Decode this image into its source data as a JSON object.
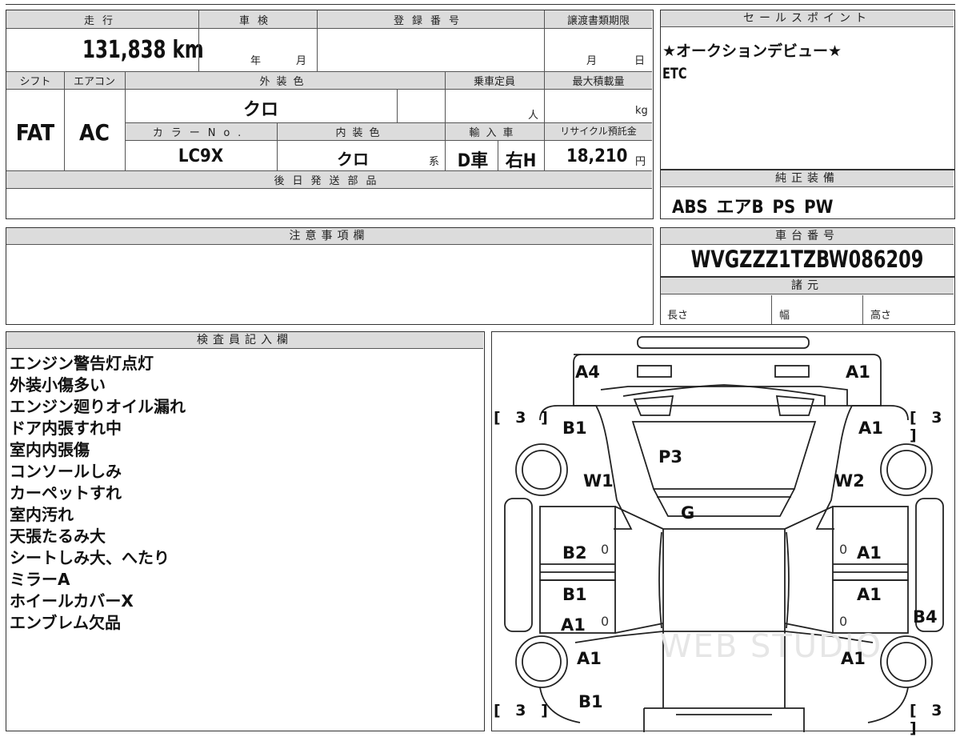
{
  "summary": {
    "headers": {
      "mileage": "走行",
      "inspection": "車検",
      "registration": "登録番号",
      "transfer_deadline": "譲渡書類期限",
      "shift": "シフト",
      "aircon": "エアコン",
      "exterior_color": "外装色",
      "capacity": "乗車定員",
      "max_load": "最大積載量",
      "color_no": "カラーNo.",
      "interior_color": "内装色",
      "import": "輸入車",
      "recycle_fee": "リサイクル預託金",
      "later_parts": "後日発送部品"
    },
    "mileage": "131,838 km",
    "inspection_year_unit": "年",
    "inspection_month_unit": "月",
    "deadline_month_unit": "月",
    "deadline_day_unit": "日",
    "shift": "FAT",
    "aircon": "AC",
    "exterior_color": "クロ",
    "capacity_unit": "人",
    "load_unit": "kg",
    "color_no": "LC9X",
    "interior_color": "クロ",
    "interior_suffix": "系",
    "import_type": "D車",
    "steering": "右H",
    "recycle_fee": "18,210",
    "recycle_unit": "円"
  },
  "sales_point": {
    "header": "セールスポイント",
    "line1": "★オークションデビュー★",
    "line2": "ETC"
  },
  "equipment": {
    "header": "純正装備",
    "items": "ABS エアB PS PW"
  },
  "notes": {
    "header": "注意事項欄"
  },
  "chassis": {
    "header": "車台番号",
    "number": "WVGZZZ1TZBW086209"
  },
  "specs": {
    "header": "諸元",
    "length": "長さ",
    "width": "幅",
    "height": "高さ"
  },
  "inspector": {
    "header": "検査員記入欄",
    "items": [
      "エンジン警告灯点灯",
      "外装小傷多い",
      "エンジン廻りオイル漏れ",
      "ドア内張すれ中",
      "室内内張傷",
      "コンソールしみ",
      "カーペットすれ",
      "室内汚れ",
      "天張たるみ大",
      "シートしみ大、へたり",
      "ミラーA",
      "ホイールカバーX",
      "エンブレム欠品"
    ]
  },
  "diagram": {
    "codes": {
      "front_left": "A4",
      "front_right": "A1",
      "fender_left": "B1",
      "fender_right": "A1",
      "windshield": "P3",
      "wheel_left": "W1",
      "wheel_right": "W2",
      "glass": "G",
      "door_fl": "B2",
      "door_fr": "A1",
      "door_rl_1": "B1",
      "door_rl_2": "A1",
      "door_rr": "A1",
      "side_right": "B4",
      "rear_fender_left": "A1",
      "rear_fender_right": "A1",
      "rear_left": "B1"
    },
    "tire_tread": "[ 3 ]",
    "zero_mark": "0",
    "watermark": "WEB STUDIO"
  }
}
